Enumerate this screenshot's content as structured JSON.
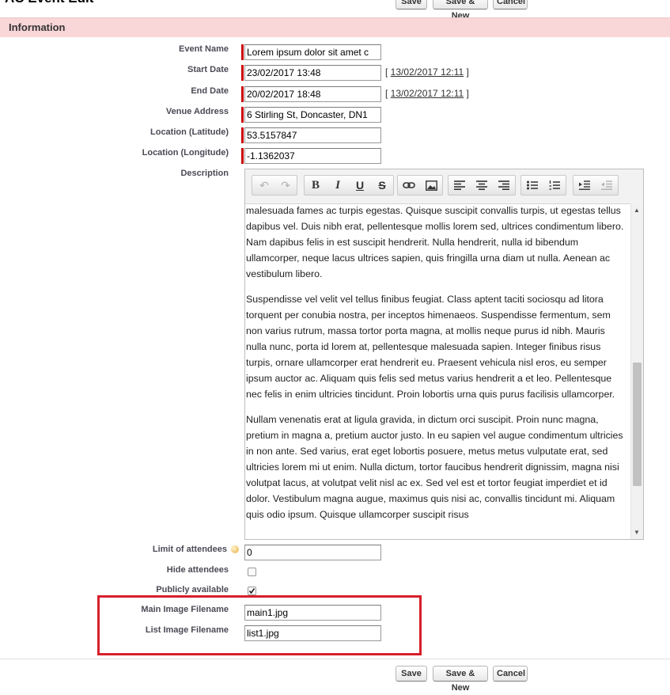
{
  "page": {
    "title": "AC Event Edit",
    "buttons": {
      "save": "Save",
      "save_new": "Save & New",
      "cancel": "Cancel"
    }
  },
  "section": {
    "title": "Information"
  },
  "fields": {
    "event_name": {
      "label": "Event Name",
      "value": "Lorem ipsum dolor sit amet c"
    },
    "start_date": {
      "label": "Start Date",
      "value": "23/02/2017 13:48",
      "today_link": "13/02/2017 12:11"
    },
    "end_date": {
      "label": "End Date",
      "value": "20/02/2017 18:48",
      "today_link": "13/02/2017 12:11"
    },
    "venue_address": {
      "label": "Venue Address",
      "value": "6 Stirling St, Doncaster, DN1"
    },
    "latitude": {
      "label": "Location (Latitude)",
      "value": "53.5157847"
    },
    "longitude": {
      "label": "Location (Longitude)",
      "value": "-1.1362037"
    },
    "description": {
      "label": "Description",
      "paragraphs": [
        "malesuada fames ac turpis egestas. Quisque suscipit convallis turpis, ut egestas tellus dapibus vel. Duis nibh erat, pellentesque mollis lorem sed, ultrices condimentum libero. Nam dapibus felis in est suscipit hendrerit. Nulla hendrerit, nulla id bibendum ullamcorper, neque lacus ultrices sapien, quis fringilla urna diam ut nulla. Aenean ac vestibulum libero.",
        "Suspendisse vel velit vel tellus finibus feugiat. Class aptent taciti sociosqu ad litora torquent per conubia nostra, per inceptos himenaeos. Suspendisse fermentum, sem non varius rutrum, massa tortor porta magna, at mollis neque purus id nibh. Mauris nulla nunc, porta id lorem at, pellentesque malesuada sapien. Integer finibus risus turpis, ornare ullamcorper erat hendrerit eu. Praesent vehicula nisl eros, eu semper ipsum auctor ac. Aliquam quis felis sed metus varius hendrerit a et leo. Pellentesque nec felis in enim ultricies tincidunt. Proin lobortis urna quis purus facilisis ullamcorper.",
        "Nullam venenatis erat at ligula gravida, in dictum orci suscipit. Proin nunc magna, pretium in magna a, pretium auctor justo. In eu sapien vel augue condimentum ultricies in non ante. Sed varius, erat eget lobortis posuere, metus metus vulputate erat, sed ultricies lorem mi ut enim. Nulla dictum, tortor faucibus hendrerit dignissim, magna nisi volutpat lacus, at volutpat velit nisl ac ex. Sed vel est et tortor feugiat imperdiet et id dolor. Vestibulum magna augue, maximus quis nisi ac, convallis tincidunt mi. Aliquam quis odio ipsum. Quisque ullamcorper suscipit risus"
      ]
    },
    "limit_attendees": {
      "label": "Limit of attendees",
      "value": "0"
    },
    "hide_attendees": {
      "label": "Hide attendees",
      "checked": false
    },
    "publicly_available": {
      "label": "Publicly available",
      "checked": true
    },
    "main_image": {
      "label": "Main Image Filename",
      "value": "main1.jpg"
    },
    "list_image": {
      "label": "List Image Filename",
      "value": "list1.jpg"
    }
  },
  "toolbar": {
    "bold": "B",
    "italic": "I",
    "underline": "U",
    "strike": "S",
    "icons": [
      "undo-icon",
      "redo-icon",
      "bold-icon",
      "italic-icon",
      "underline-icon",
      "strikethrough-icon",
      "link-icon",
      "image-icon",
      "align-left-icon",
      "align-center-icon",
      "align-right-icon",
      "bulleted-list-icon",
      "numbered-list-icon",
      "indent-icon",
      "outdent-icon"
    ]
  },
  "colors": {
    "header_bg": "#f9d6d8",
    "required": "#cc0000",
    "highlight": "#d71f2b"
  }
}
